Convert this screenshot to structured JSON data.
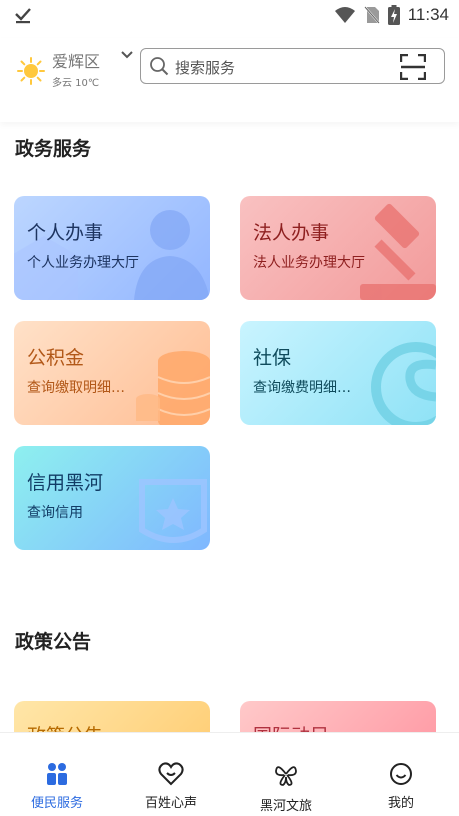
{
  "status_bar": {
    "time": "11:34"
  },
  "header": {
    "district": "爱辉区",
    "weather": "多云 10℃",
    "search_placeholder": "搜索服务"
  },
  "sections": {
    "government": "政务服务",
    "policy": "政策公告"
  },
  "cards": [
    {
      "title": "个人办事",
      "subtitle": "个人业务办理大厅"
    },
    {
      "title": "法人办事",
      "subtitle": "法人业务办理大厅"
    },
    {
      "title": "公积金",
      "subtitle": "查询缴取明细…"
    },
    {
      "title": "社保",
      "subtitle": "查询缴费明细…"
    },
    {
      "title": "信用黑河",
      "subtitle": "查询信用"
    }
  ],
  "policy_cards": [
    {
      "title": "政策公告"
    },
    {
      "title": "国际动目"
    }
  ],
  "bottom_nav": [
    {
      "label": "便民服务",
      "active": true
    },
    {
      "label": "百姓心声",
      "active": false
    },
    {
      "label": "黑河文旅",
      "active": false
    },
    {
      "label": "我的",
      "active": false
    }
  ],
  "colors": {
    "accent": "#2c6be0",
    "sun": "#ffc83d"
  }
}
